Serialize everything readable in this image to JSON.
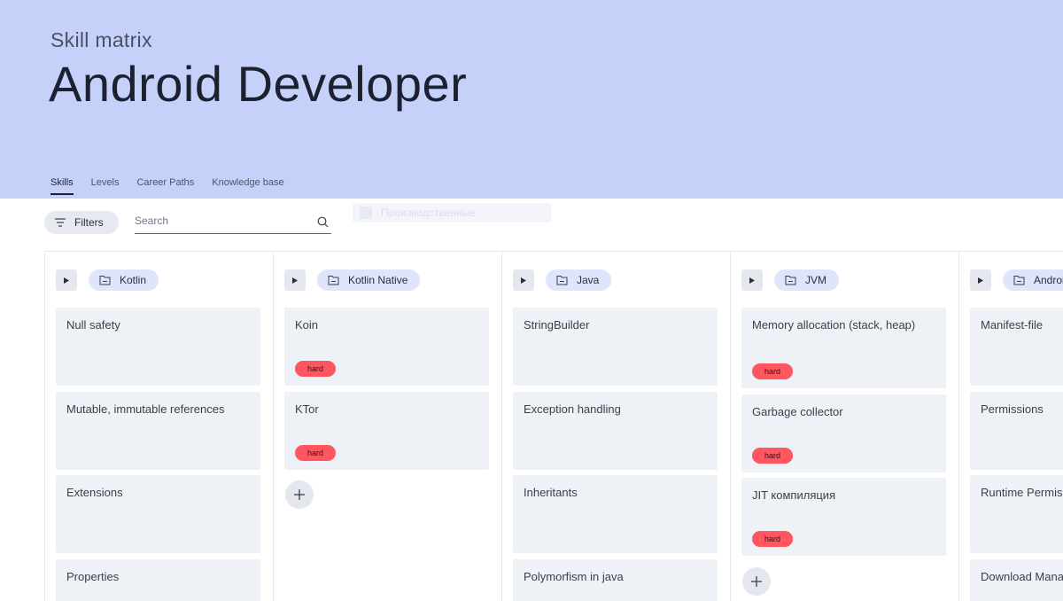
{
  "header": {
    "eyebrow": "Skill matrix",
    "title": "Android Developer"
  },
  "tabs": [
    {
      "label": "Skills",
      "active": true
    },
    {
      "label": "Levels",
      "active": false
    },
    {
      "label": "Career Paths",
      "active": false
    },
    {
      "label": "Knowledge base",
      "active": false
    }
  ],
  "ghost_search": {
    "text": "Производственные"
  },
  "toolbar": {
    "filters_label": "Filters",
    "search_placeholder": "Search"
  },
  "columns": [
    {
      "group": "Kotlin",
      "cards": [
        {
          "title": "Null safety",
          "badge": ""
        },
        {
          "title": "Mutable, immutable references",
          "badge": ""
        },
        {
          "title": "Extensions",
          "badge": ""
        },
        {
          "title": "Properties",
          "badge": ""
        }
      ]
    },
    {
      "group": "Kotlin Native",
      "cards": [
        {
          "title": "Koin",
          "badge": "hard"
        },
        {
          "title": "KTor",
          "badge": "hard"
        }
      ]
    },
    {
      "group": "Java",
      "cards": [
        {
          "title": "StringBuilder",
          "badge": ""
        },
        {
          "title": "Exception handling",
          "badge": ""
        },
        {
          "title": "Inheritants",
          "badge": ""
        },
        {
          "title": "Polymorfism in java",
          "badge": ""
        }
      ]
    },
    {
      "group": "JVM",
      "cards": [
        {
          "title": "Memory allocation (stack, heap)",
          "badge": "hard"
        },
        {
          "title": "Garbage collector",
          "badge": "hard"
        },
        {
          "title": "JIT компиляция",
          "badge": "hard"
        }
      ]
    },
    {
      "group": "Android",
      "cards": [
        {
          "title": "Manifest-file",
          "badge": ""
        },
        {
          "title": "Permissions",
          "badge": ""
        },
        {
          "title": "Runtime Permissions",
          "badge": ""
        },
        {
          "title": "Download Manager",
          "badge": ""
        }
      ]
    }
  ],
  "colors": {
    "hero_bg": "#c5d1f8",
    "chip_bg": "#dfe5fb",
    "card_bg": "#eef1f5",
    "badge_hard": "#ff5660"
  }
}
